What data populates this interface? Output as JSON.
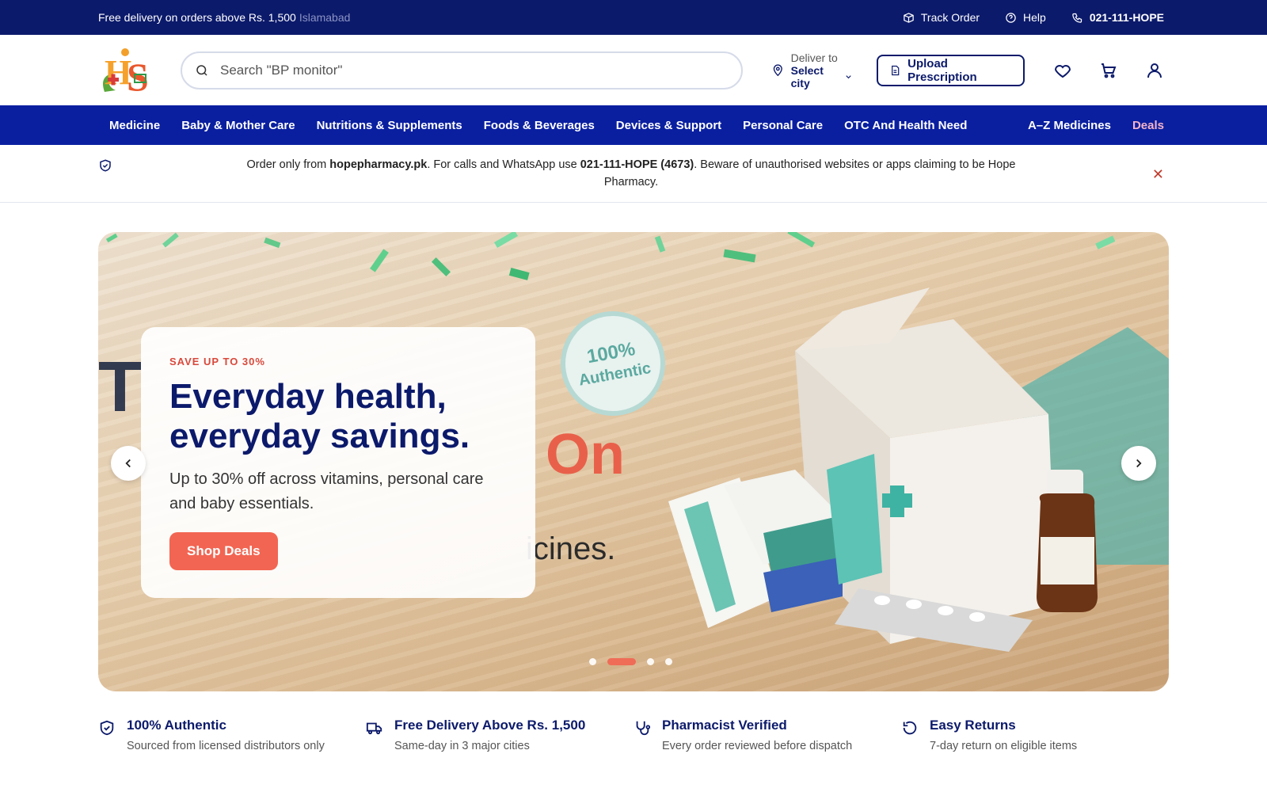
{
  "topbar": {
    "promo": "Free delivery on orders above Rs. 1,500",
    "city": "Islamabad",
    "track_order": "Track Order",
    "help": "Help",
    "phone": "021-111-HOPE"
  },
  "header": {
    "search_placeholder": "Search \"BP monitor\"",
    "deliver_label": "Deliver to",
    "deliver_city": "Select city",
    "upload_prescription": "Upload Prescription"
  },
  "nav": {
    "items": [
      "Medicine",
      "Baby & Mother Care",
      "Nutritions & Supplements",
      "Foods & Beverages",
      "Devices & Support",
      "Personal Care",
      "OTC And Health Need"
    ],
    "az": "A–Z Medicines",
    "deals": "Deals"
  },
  "notice": {
    "part1": "Order only from ",
    "site": "hopepharmacy.pk",
    "part2": ". For calls and WhatsApp use ",
    "phone": "021-111-HOPE (4673)",
    "part3": ". Beware of unauthorised websites or apps claiming to be Hope Pharmacy."
  },
  "hero": {
    "kicker": "SAVE UP TO 30%",
    "title_line1": "Everyday health,",
    "title_line2": "everyday savings.",
    "desc": "Up to 30% off across vitamins, personal care and baby essentials.",
    "cta": "Shop Deals",
    "badge_line1": "100%",
    "badge_line2": "Authentic",
    "ghost_on": "On",
    "ghost_icines": "icines.",
    "slides_count": 4,
    "active_slide": 2
  },
  "features": [
    {
      "icon": "shield-check-icon",
      "title": "100% Authentic",
      "sub": "Sourced from licensed distributors only"
    },
    {
      "icon": "truck-icon",
      "title": "Free Delivery Above Rs. 1,500",
      "sub": "Same-day in 3 major cities"
    },
    {
      "icon": "stethoscope-icon",
      "title": "Pharmacist Verified",
      "sub": "Every order reviewed before dispatch"
    },
    {
      "icon": "return-icon",
      "title": "Easy Returns",
      "sub": "7-day return on eligible items"
    }
  ],
  "colors": {
    "topbar": "#0c1a6b",
    "nav": "#0a1fa0",
    "accent": "#f26552",
    "navy_text": "#0c1a6b"
  }
}
